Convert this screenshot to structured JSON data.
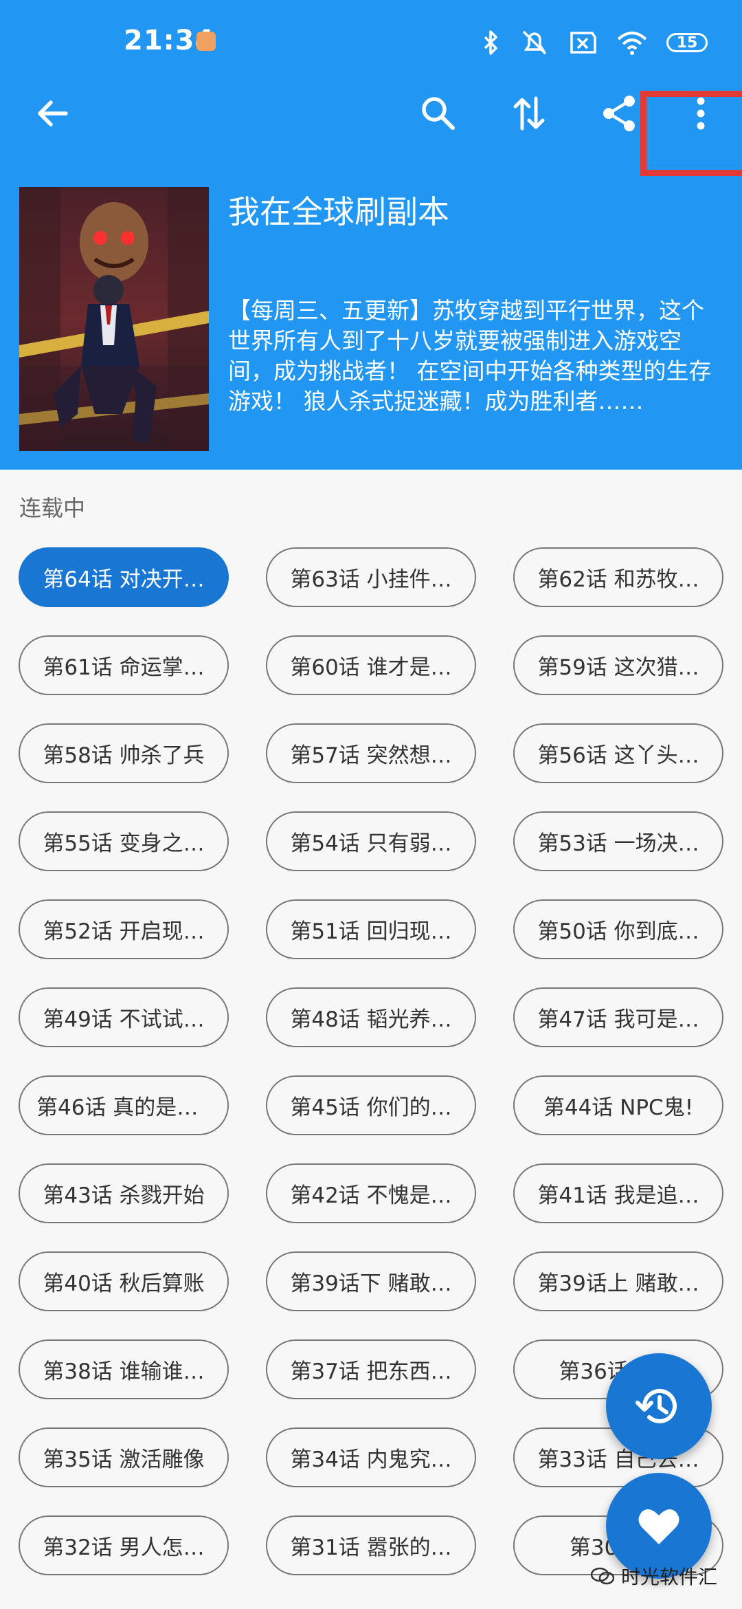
{
  "status_bar": {
    "time": "21:34",
    "battery": "15"
  },
  "book": {
    "title": "我在全球刷副本",
    "description": "【每周三、五更新】苏牧穿越到平行世界，这个世界所有人到了十八岁就要被强制进入游戏空间，成为挑战者！ 在空间中开始各种类型的生存游戏！ 狼人杀式捉迷藏！成为胜利者……"
  },
  "status_label": "连载中",
  "chapters": [
    "第64话 对决开…",
    "第63话 小挂件…",
    "第62话 和苏牧…",
    "第61话 命运掌…",
    "第60话 谁才是…",
    "第59话 这次猎…",
    "第58话 帅杀了兵",
    "第57话 突然想…",
    "第56话 这丫头…",
    "第55话 变身之…",
    "第54话 只有弱…",
    "第53话 一场决…",
    "第52话 开启现…",
    "第51话 回归现…",
    "第50话 你到底…",
    "第49话 不试试…",
    "第48话 韬光养…",
    "第47话 我可是…",
    "第46话 真的是N…",
    "第45话 你们的…",
    "第44话 NPC鬼!",
    "第43话 杀戮开始",
    "第42话 不愧是…",
    "第41话 我是追…",
    "第40话 秋后算账",
    "第39话下 赌敢…",
    "第39话上 赌敢…",
    "第38话 谁输谁…",
    "第37话 把东西…",
    "第36话 选…",
    "第35话 激活雕像",
    "第34话 内鬼究…",
    "第33话 自己去…",
    "第32话 男人怎…",
    "第31话 嚣张的…",
    "第30话 …"
  ],
  "watermark": "时光软件汇",
  "icons": [
    "back-arrow-icon",
    "search-icon",
    "sort-icon",
    "share-icon",
    "more-vert-icon",
    "history-icon",
    "heart-icon"
  ],
  "colors": {
    "primary": "#2196f3",
    "active_chip": "#1976d2",
    "highlight": "#e53935"
  }
}
